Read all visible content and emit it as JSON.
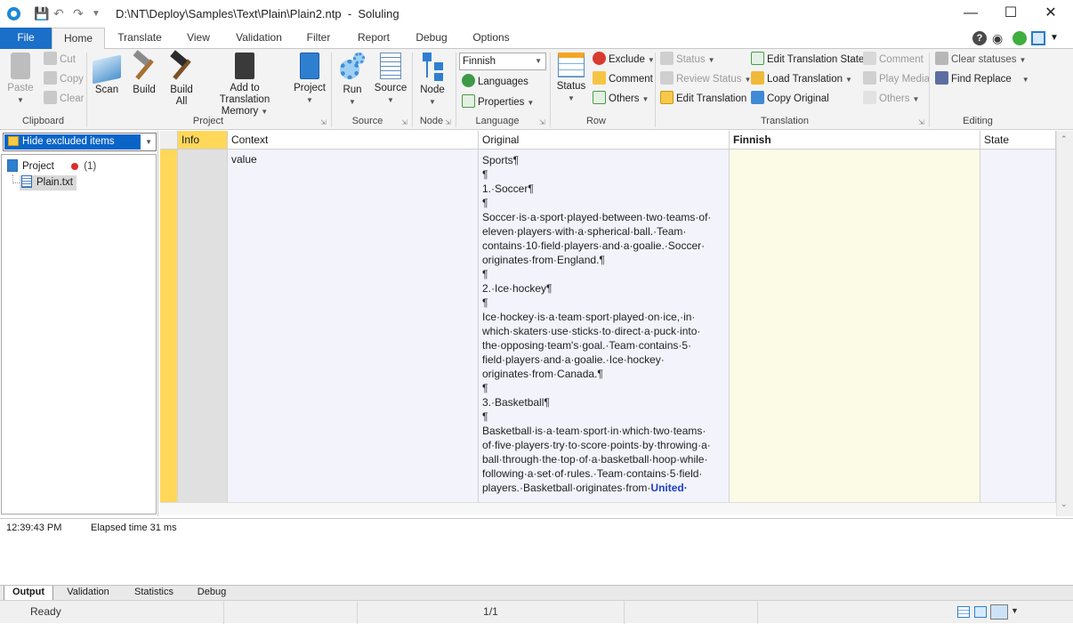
{
  "window": {
    "title": "D:\\NT\\Deploy\\Samples\\Text\\Plain\\Plain2.ntp  -  Soluling",
    "minimize": "—",
    "maximize": "☐",
    "close": "✕"
  },
  "ribbon_tabs": [
    "File",
    "Home",
    "Translate",
    "View",
    "Validation",
    "Filter",
    "Report",
    "Debug",
    "Options"
  ],
  "clipboard": {
    "paste": "Paste",
    "cut": "Cut",
    "copy": "Copy",
    "clear": "Clear",
    "label": "Clipboard"
  },
  "project": {
    "scan": "Scan",
    "build": "Build",
    "build_all_1": "Build",
    "build_all_2": "All",
    "add_tm_1": "Add to Translation",
    "add_tm_2": "Memory",
    "project": "Project",
    "label": "Project"
  },
  "source": {
    "run": "Run",
    "source": "Source",
    "label": "Source"
  },
  "node": {
    "node": "Node",
    "label": "Node"
  },
  "language": {
    "selected": "Finnish",
    "languages": "Languages",
    "properties": "Properties",
    "label": "Language"
  },
  "row": {
    "status": "Status",
    "exclude": "Exclude",
    "comment": "Comment",
    "others": "Others",
    "label": "Row"
  },
  "translation": {
    "status": "Status",
    "review_status": "Review Status",
    "edit_translation": "Edit Translation",
    "edit_translation_state": "Edit Translation State",
    "load_translation": "Load Translation",
    "copy_original": "Copy Original",
    "comment": "Comment",
    "play_media": "Play Media",
    "others": "Others",
    "label": "Translation"
  },
  "editing": {
    "clear_statuses": "Clear statuses",
    "find_replace": "Find Replace",
    "label": "Editing"
  },
  "left_pane": {
    "filter": "Hide excluded items",
    "tree_project": "Project",
    "tree_count": "(1)",
    "tree_file": "Plain.txt"
  },
  "grid": {
    "headers": {
      "info": "Info",
      "context": "Context",
      "original": "Original",
      "finnish": "Finnish",
      "state": "State"
    },
    "row": {
      "context": "value",
      "original": "Sports¶\n¶\n1.·Soccer¶\n¶\nSoccer·is·a·sport·played·between·two·teams·of·\neleven·players·with·a·spherical·ball.·Team·\ncontains·10·field·players·and·a·goalie.·Soccer·\noriginates·from·England.¶\n¶\n2.·Ice·hockey¶\n¶\nIce·hockey·is·a·team·sport·played·on·ice,·in·\nwhich·skaters·use·sticks·to·direct·a·puck·into·\nthe·opposing·team's·goal.·Team·contains·5·\nfield·players·and·a·goalie.·Ice·hockey·\noriginates·from·Canada.¶\n¶\n3.·Basketball¶\n¶\nBasketball·is·a·team·sport·in·which·two·teams·\nof·five·players·try·to·score·points·by·throwing·a·\nball·through·the·top·of·a·basketball·hoop·while·\nfollowing·a·set·of·rules.·Team·contains·5·field·\nplayers.·Basketball·originates·from·",
      "original_highlight": "United·"
    }
  },
  "output": {
    "time": "12:39:43 PM",
    "message": "Elapsed time 31 ms"
  },
  "bottom_tabs": [
    "Output",
    "Validation",
    "Statistics",
    "Debug"
  ],
  "statusbar": {
    "state": "Ready",
    "page": "1/1"
  }
}
